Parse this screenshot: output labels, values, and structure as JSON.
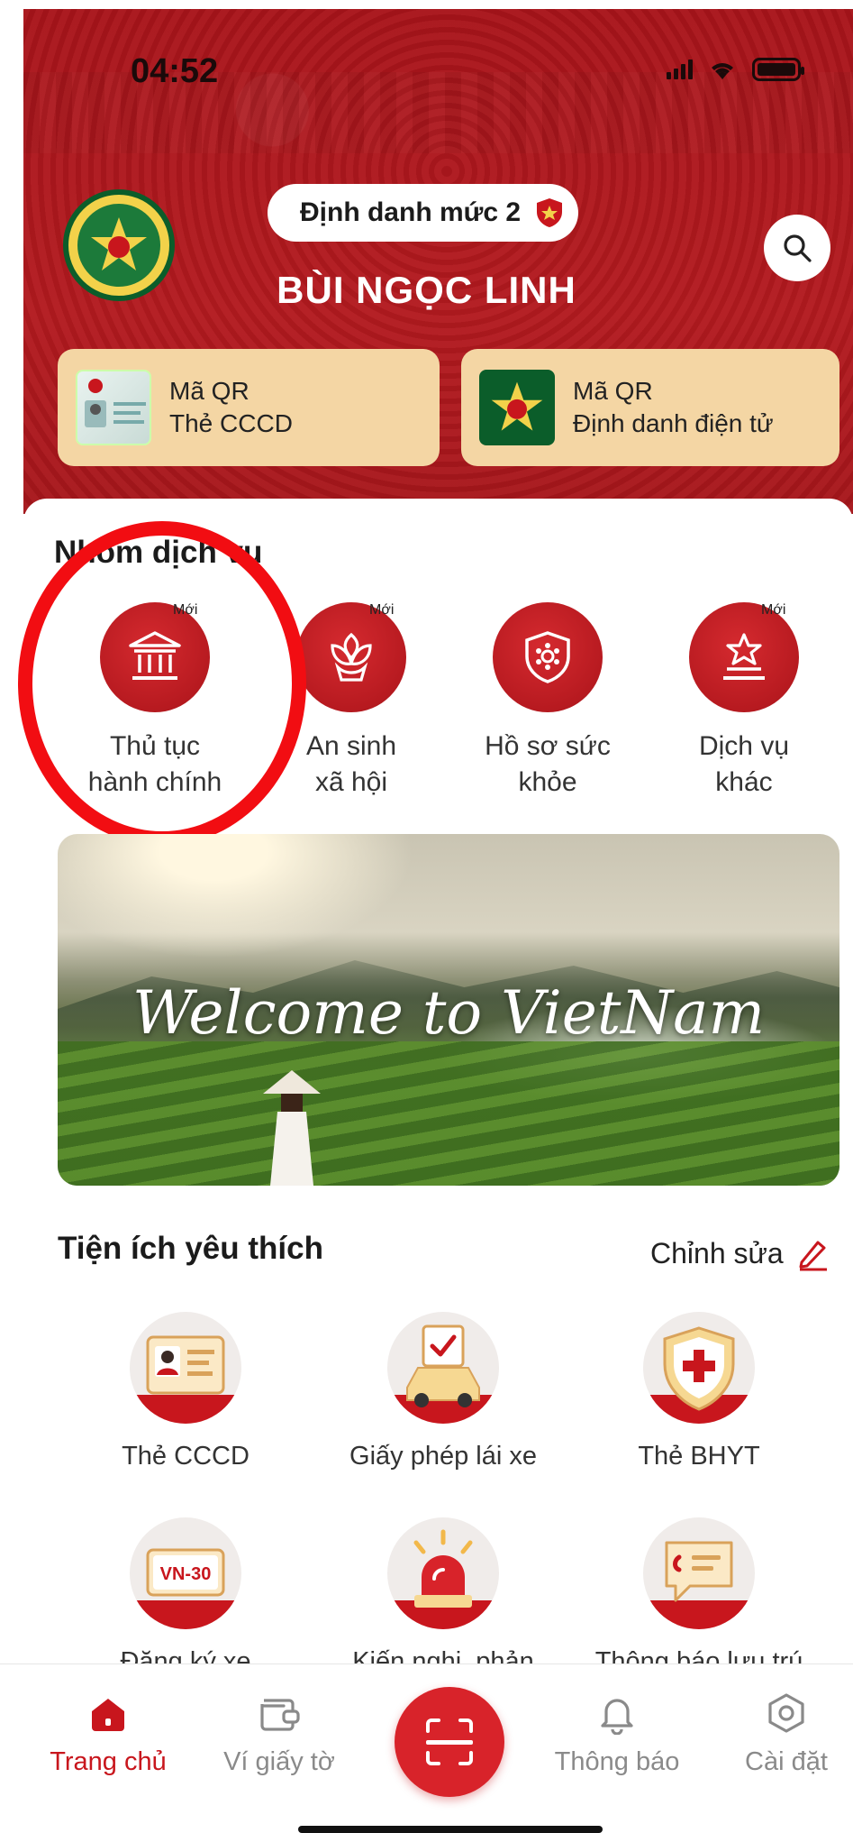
{
  "status_bar": {
    "time": "04:52"
  },
  "header": {
    "level_label": "Định danh mức 2",
    "user_name": "BÙI NGỌC LINH",
    "qr_cards": [
      {
        "line1": "Mã QR",
        "line2": "Thẻ CCCD"
      },
      {
        "line1": "Mã QR",
        "line2": "Định danh điện tử"
      }
    ]
  },
  "services": {
    "title": "Nhóm dịch vụ",
    "new_badge": "Mới",
    "items": [
      {
        "line1": "Thủ tục",
        "line2": "hành chính",
        "is_new": true,
        "icon": "bank-icon"
      },
      {
        "line1": "An sinh",
        "line2": "xã hội",
        "is_new": true,
        "icon": "lotus-hands-icon"
      },
      {
        "line1": "Hồ sơ sức",
        "line2": "khỏe",
        "is_new": false,
        "icon": "health-shield-icon"
      },
      {
        "line1": "Dịch vụ",
        "line2": "khác",
        "is_new": true,
        "icon": "star-podium-icon"
      }
    ]
  },
  "banner": {
    "text": "Welcome to VietNam"
  },
  "favorites": {
    "title": "Tiện ích yêu thích",
    "edit_label": "Chỉnh sửa",
    "items": [
      {
        "label": "Thẻ CCCD",
        "icon": "id-card-icon"
      },
      {
        "label": "Giấy phép lái xe",
        "icon": "car-license-icon"
      },
      {
        "label": "Thẻ BHYT",
        "icon": "health-insurance-icon"
      },
      {
        "label": "Đăng ký xe",
        "icon": "plate-icon",
        "plate_text": "VN-30"
      },
      {
        "label": "Kiến nghị, phản",
        "icon": "siren-icon"
      },
      {
        "label": "Thông báo lưu trú",
        "icon": "chat-note-icon"
      }
    ]
  },
  "bottom_nav": {
    "items": [
      {
        "label": "Trang chủ",
        "icon": "home-icon",
        "active": true
      },
      {
        "label": "Ví giấy tờ",
        "icon": "wallet-icon",
        "active": false
      },
      {
        "label": "Thông báo",
        "icon": "bell-icon",
        "active": false
      },
      {
        "label": "Cài đặt",
        "icon": "settings-icon",
        "active": false
      }
    ]
  },
  "colors": {
    "brand_red": "#c8161d",
    "header_red": "#a8141a",
    "card_beige": "#f4d6a4",
    "highlight": "#f20d12"
  }
}
